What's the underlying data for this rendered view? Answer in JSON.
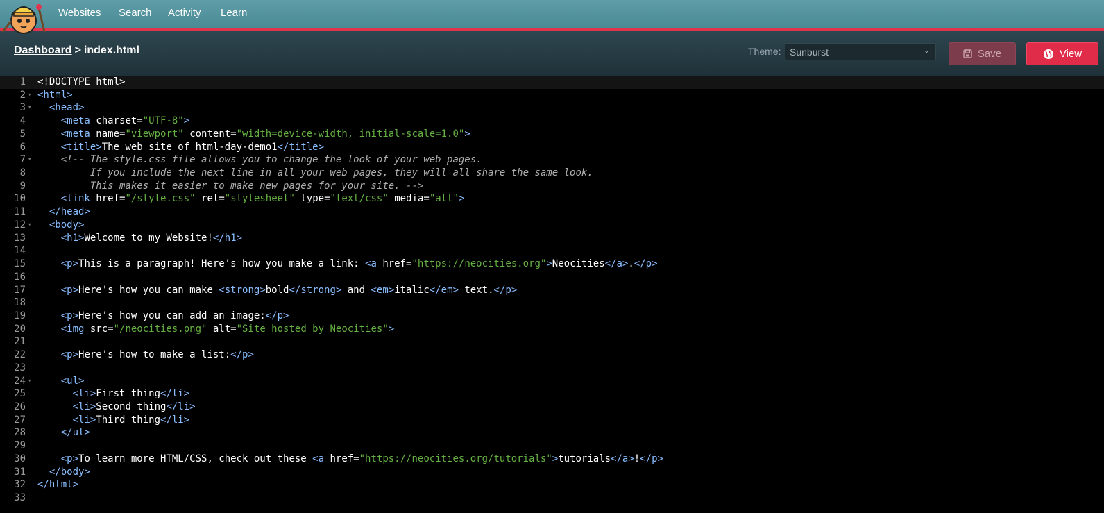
{
  "nav": {
    "logo_name": "neocities-cat-logo",
    "links": [
      "Websites",
      "Search",
      "Activity",
      "Learn"
    ]
  },
  "breadcrumb": {
    "root": "Dashboard",
    "separator": ">",
    "current": "index.html"
  },
  "theme": {
    "label": "Theme:",
    "selected": "Sunburst"
  },
  "buttons": {
    "save": "Save",
    "view": "View"
  },
  "colors": {
    "accent": "#e02c48",
    "tag": "#89bdff",
    "string": "#65b042",
    "comment": "#aeaeae"
  },
  "editor": {
    "active_line": 1,
    "fold_lines": [
      2,
      3,
      7,
      12,
      24
    ],
    "lines": [
      [
        [
          "p",
          "<!DOCTYPE html>"
        ]
      ],
      [
        [
          "t",
          "<html>"
        ]
      ],
      [
        [
          "p",
          "  "
        ],
        [
          "t",
          "<head>"
        ]
      ],
      [
        [
          "p",
          "    "
        ],
        [
          "t",
          "<meta"
        ],
        [
          "p",
          " charset="
        ],
        [
          "s",
          "\"UTF-8\""
        ],
        [
          "t",
          ">"
        ]
      ],
      [
        [
          "p",
          "    "
        ],
        [
          "t",
          "<meta"
        ],
        [
          "p",
          " name="
        ],
        [
          "s",
          "\"viewport\""
        ],
        [
          "p",
          " content="
        ],
        [
          "s",
          "\"width=device-width, initial-scale=1.0\""
        ],
        [
          "t",
          ">"
        ]
      ],
      [
        [
          "p",
          "    "
        ],
        [
          "t",
          "<title>"
        ],
        [
          "p",
          "The web site of html-day-demo1"
        ],
        [
          "t",
          "</title>"
        ]
      ],
      [
        [
          "p",
          "    "
        ],
        [
          "c",
          "<!-- The style.css file allows you to change the look of your web pages."
        ]
      ],
      [
        [
          "c",
          "         If you include the next line in all your web pages, they will all share the same look."
        ]
      ],
      [
        [
          "c",
          "         This makes it easier to make new pages for your site. -->"
        ]
      ],
      [
        [
          "p",
          "    "
        ],
        [
          "t",
          "<link"
        ],
        [
          "p",
          " href="
        ],
        [
          "s",
          "\"/style.css\""
        ],
        [
          "p",
          " rel="
        ],
        [
          "s",
          "\"stylesheet\""
        ],
        [
          "p",
          " type="
        ],
        [
          "s",
          "\"text/css\""
        ],
        [
          "p",
          " media="
        ],
        [
          "s",
          "\"all\""
        ],
        [
          "t",
          ">"
        ]
      ],
      [
        [
          "p",
          "  "
        ],
        [
          "t",
          "</head>"
        ]
      ],
      [
        [
          "p",
          "  "
        ],
        [
          "t",
          "<body>"
        ]
      ],
      [
        [
          "p",
          "    "
        ],
        [
          "t",
          "<h1>"
        ],
        [
          "p",
          "Welcome to my Website!"
        ],
        [
          "t",
          "</h1>"
        ]
      ],
      [],
      [
        [
          "p",
          "    "
        ],
        [
          "t",
          "<p>"
        ],
        [
          "p",
          "This is a paragraph! Here's how you make a link: "
        ],
        [
          "t",
          "<a"
        ],
        [
          "p",
          " href="
        ],
        [
          "s",
          "\"https://neocities.org\""
        ],
        [
          "t",
          ">"
        ],
        [
          "p",
          "Neocities"
        ],
        [
          "t",
          "</a>"
        ],
        [
          "p",
          "."
        ],
        [
          "t",
          "</p>"
        ]
      ],
      [],
      [
        [
          "p",
          "    "
        ],
        [
          "t",
          "<p>"
        ],
        [
          "p",
          "Here's how you can make "
        ],
        [
          "t",
          "<strong>"
        ],
        [
          "p",
          "bold"
        ],
        [
          "t",
          "</strong>"
        ],
        [
          "p",
          " and "
        ],
        [
          "t",
          "<em>"
        ],
        [
          "p",
          "italic"
        ],
        [
          "t",
          "</em>"
        ],
        [
          "p",
          " text."
        ],
        [
          "t",
          "</p>"
        ]
      ],
      [],
      [
        [
          "p",
          "    "
        ],
        [
          "t",
          "<p>"
        ],
        [
          "p",
          "Here's how you can add an image:"
        ],
        [
          "t",
          "</p>"
        ]
      ],
      [
        [
          "p",
          "    "
        ],
        [
          "t",
          "<img"
        ],
        [
          "p",
          " src="
        ],
        [
          "s",
          "\"/neocities.png\""
        ],
        [
          "p",
          " alt="
        ],
        [
          "s",
          "\"Site hosted by Neocities\""
        ],
        [
          "t",
          ">"
        ]
      ],
      [],
      [
        [
          "p",
          "    "
        ],
        [
          "t",
          "<p>"
        ],
        [
          "p",
          "Here's how to make a list:"
        ],
        [
          "t",
          "</p>"
        ]
      ],
      [],
      [
        [
          "p",
          "    "
        ],
        [
          "t",
          "<ul>"
        ]
      ],
      [
        [
          "p",
          "      "
        ],
        [
          "t",
          "<li>"
        ],
        [
          "p",
          "First thing"
        ],
        [
          "t",
          "</li>"
        ]
      ],
      [
        [
          "p",
          "      "
        ],
        [
          "t",
          "<li>"
        ],
        [
          "p",
          "Second thing"
        ],
        [
          "t",
          "</li>"
        ]
      ],
      [
        [
          "p",
          "      "
        ],
        [
          "t",
          "<li>"
        ],
        [
          "p",
          "Third thing"
        ],
        [
          "t",
          "</li>"
        ]
      ],
      [
        [
          "p",
          "    "
        ],
        [
          "t",
          "</ul>"
        ]
      ],
      [],
      [
        [
          "p",
          "    "
        ],
        [
          "t",
          "<p>"
        ],
        [
          "p",
          "To learn more HTML/CSS, check out these "
        ],
        [
          "t",
          "<a"
        ],
        [
          "p",
          " href="
        ],
        [
          "s",
          "\"https://neocities.org/tutorials\""
        ],
        [
          "t",
          ">"
        ],
        [
          "p",
          "tutorials"
        ],
        [
          "t",
          "</a>"
        ],
        [
          "p",
          "!"
        ],
        [
          "t",
          "</p>"
        ]
      ],
      [
        [
          "p",
          "  "
        ],
        [
          "t",
          "</body>"
        ]
      ],
      [
        [
          "t",
          "</html>"
        ]
      ],
      []
    ]
  }
}
